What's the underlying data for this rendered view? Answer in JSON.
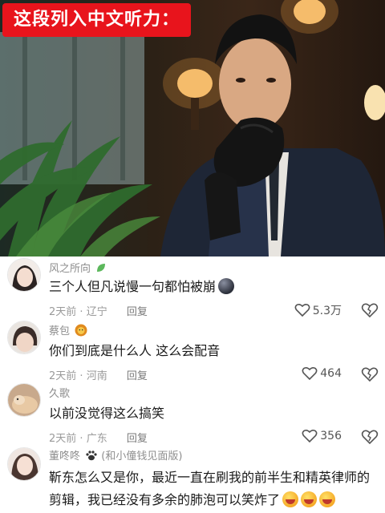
{
  "caption": "这段列入中文听力：",
  "comments": [
    {
      "user": "风之所向",
      "text": "三个人但凡说慢一句都怕被崩",
      "time": "2天前",
      "location": "辽宁",
      "reply": "回复",
      "likes": "5.3万"
    },
    {
      "user": "蔡包",
      "text": "你们到底是什么人 这么会配音",
      "time": "2天前",
      "location": "河南",
      "reply": "回复",
      "likes": "464"
    },
    {
      "user": "久歌",
      "text": "以前没觉得这么搞笑",
      "time": "2天前",
      "location": "广东",
      "reply": "回复",
      "likes": "356"
    },
    {
      "user": "董咚咚",
      "user_suffix": "(和小僮钱见面版)",
      "text": "靳东怎么又是你，最近一直在刷我的前半生和精英律师的剪辑，我已经没有多余的肺泡可以笑炸了"
    }
  ],
  "icons": {
    "like": "heart-outline-icon",
    "dislike": "broken-heart-icon",
    "leaf": "leaf-icon",
    "lion": "lion-emoji-icon",
    "paw": "paw-icon",
    "laugh": "laughing-emoji-icon"
  },
  "colors": {
    "caption_bg": "#e8141c",
    "username": "#8e8e8e",
    "meta": "#9a9a9a"
  }
}
